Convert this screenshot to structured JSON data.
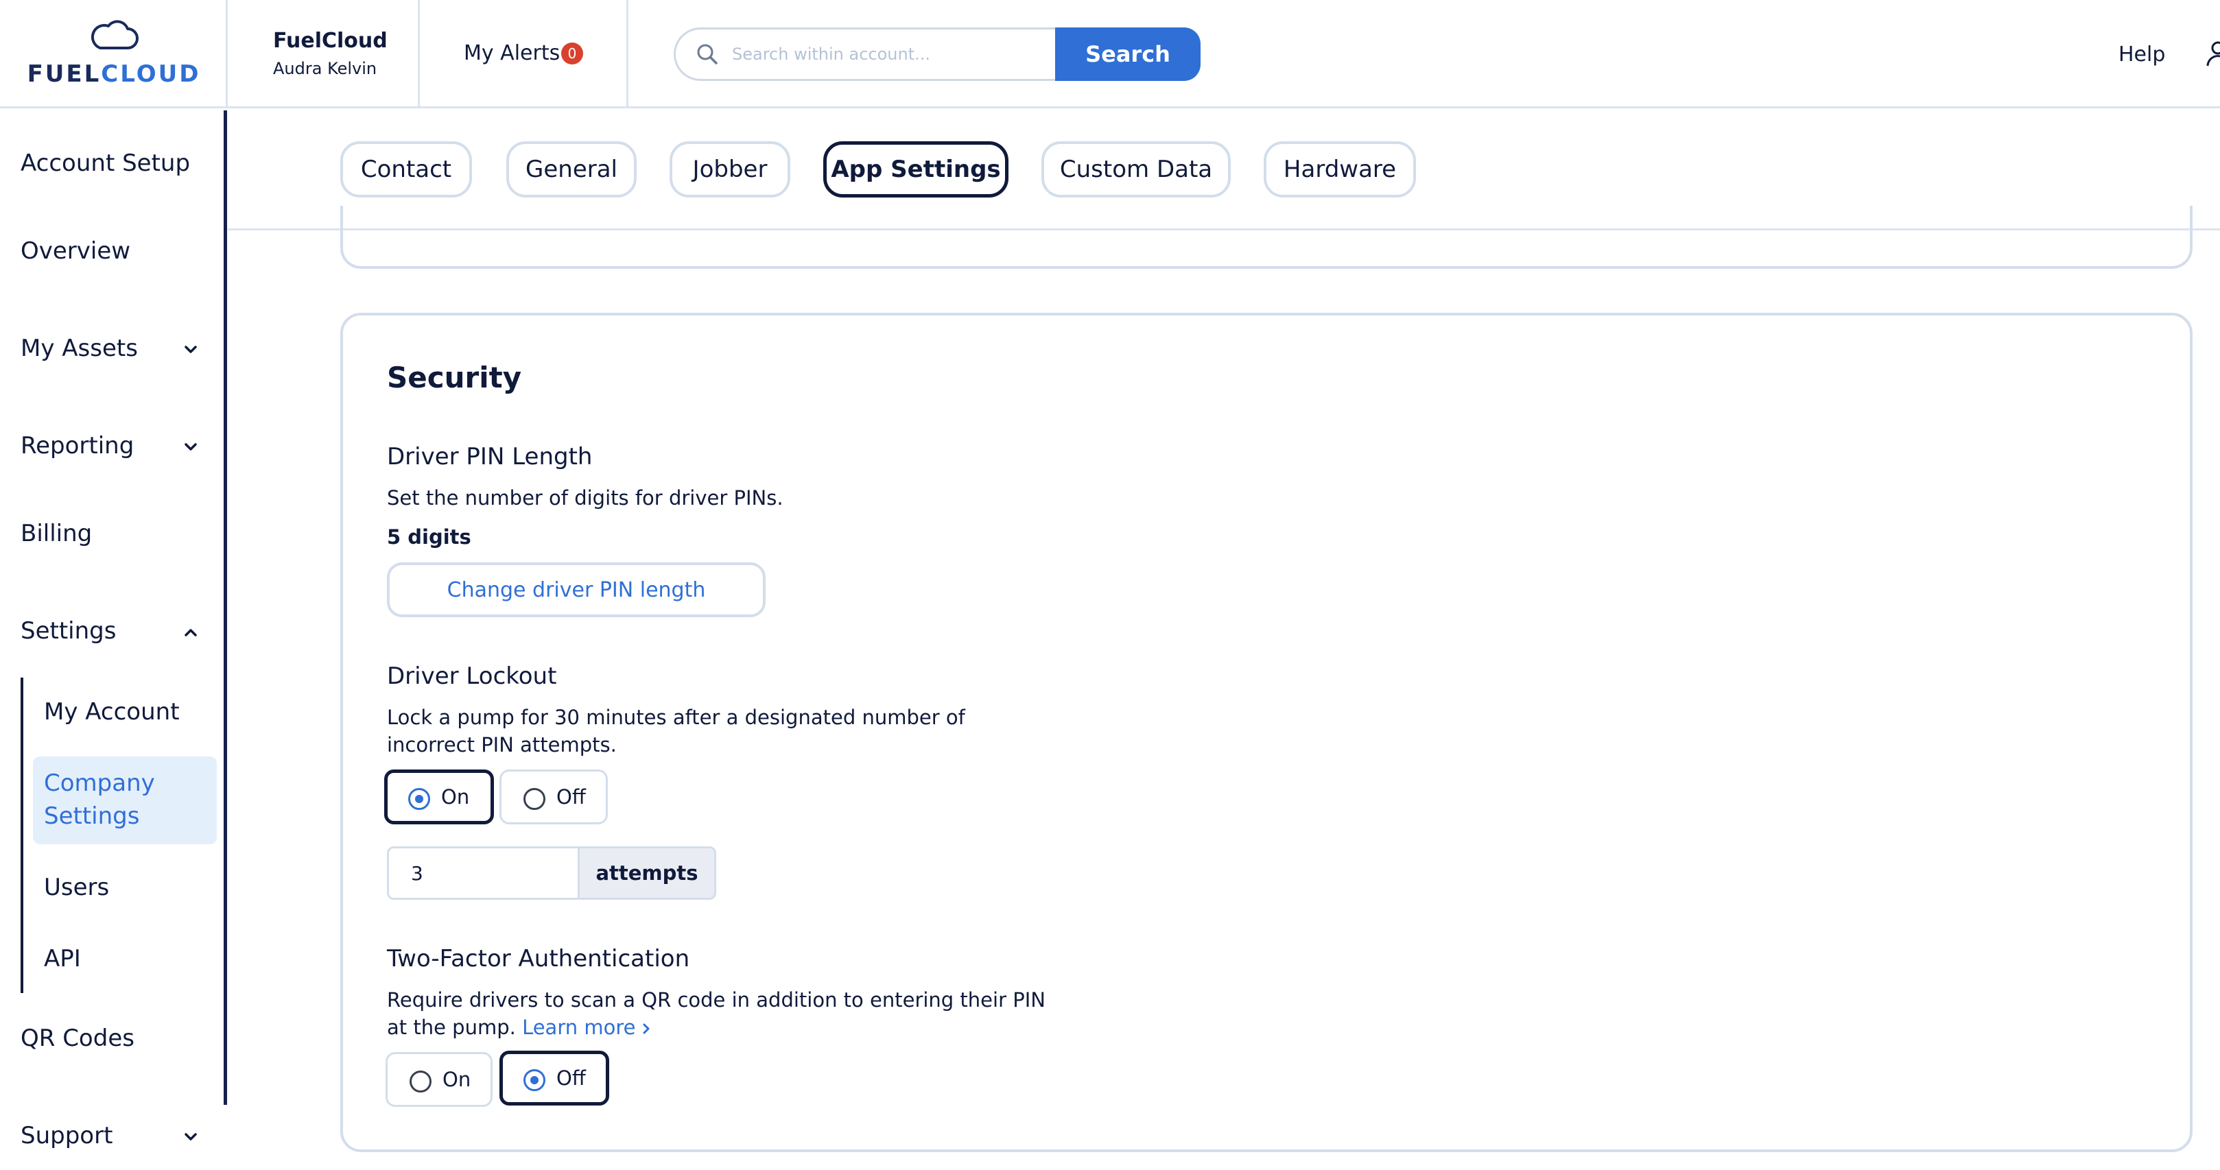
{
  "brand": {
    "logo_part1": "FUEL",
    "logo_part2": "CLOUD"
  },
  "header": {
    "account_name": "FuelCloud",
    "account_user": "Audra Kelvin",
    "alerts_label": "My Alerts",
    "alerts_count": "0",
    "search_placeholder": "Search within account...",
    "search_button": "Search",
    "help_label": "Help"
  },
  "sidebar": {
    "items": [
      {
        "label": "Account Setup"
      },
      {
        "label": "Overview"
      },
      {
        "label": "My Assets",
        "expandable": true
      },
      {
        "label": "Reporting",
        "expandable": true
      },
      {
        "label": "Billing"
      },
      {
        "label": "Settings",
        "expanded": true
      },
      {
        "label": "QR Codes"
      },
      {
        "label": "Support",
        "expandable": true
      }
    ],
    "settings_sub": [
      {
        "label": "My Account"
      },
      {
        "label": "Company Settings",
        "active": true
      },
      {
        "label": "Users"
      },
      {
        "label": "API"
      }
    ]
  },
  "tabs": [
    {
      "label": "Contact"
    },
    {
      "label": "General"
    },
    {
      "label": "Jobber"
    },
    {
      "label": "App Settings",
      "active": true
    },
    {
      "label": "Custom Data"
    },
    {
      "label": "Hardware"
    }
  ],
  "security": {
    "title": "Security",
    "pin": {
      "title": "Driver PIN Length",
      "description": "Set the number of digits for driver PINs.",
      "value": "5 digits",
      "button": "Change driver PIN length"
    },
    "lockout": {
      "title": "Driver Lockout",
      "description": "Lock a pump for 30 minutes after a designated number of incorrect PIN attempts.",
      "on_label": "On",
      "off_label": "Off",
      "selected": "On",
      "attempts_value": "3",
      "attempts_unit": "attempts"
    },
    "two_factor": {
      "title": "Two-Factor Authentication",
      "description": "Require drivers to scan a QR code in addition to entering their PIN at the pump.",
      "learn_more": "Learn more",
      "on_label": "On",
      "off_label": "Off",
      "selected": "Off"
    }
  },
  "colors": {
    "accent": "#2f6fd6",
    "navy": "#101a3b",
    "border": "#d3deeb",
    "active_bg": "#e4effc",
    "badge": "#d8412f"
  }
}
